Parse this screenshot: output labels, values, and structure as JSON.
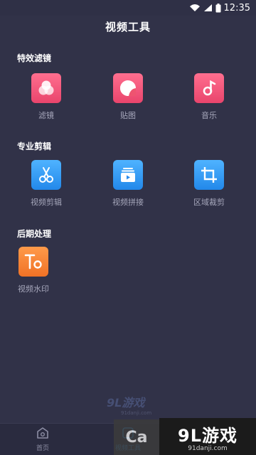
{
  "status_bar": {
    "time": "12:35"
  },
  "header": {
    "title": "视频工具"
  },
  "sections": [
    {
      "title": "特效滤镜",
      "items": [
        {
          "label": "滤镜",
          "icon": "filter-icon",
          "color": "#f0536f"
        },
        {
          "label": "贴图",
          "icon": "sticker-icon",
          "color": "#f0536f"
        },
        {
          "label": "音乐",
          "icon": "music-note-icon",
          "color": "#f0536f"
        }
      ]
    },
    {
      "title": "专业剪辑",
      "items": [
        {
          "label": "视频剪辑",
          "icon": "scissors-icon",
          "color": "#2f93f0"
        },
        {
          "label": "视频拼接",
          "icon": "video-stack-icon",
          "color": "#2f93f0"
        },
        {
          "label": "区域裁剪",
          "icon": "crop-icon",
          "color": "#2f93f0"
        }
      ]
    },
    {
      "title": "后期处理",
      "items": [
        {
          "label": "视频水印",
          "icon": "text-watermark-icon",
          "color": "#f7822f"
        }
      ]
    }
  ],
  "watermark": {
    "main": "9L游戏",
    "sub": "91danji.com"
  },
  "bottom_nav": {
    "items": [
      {
        "label": "首页",
        "icon": "home-icon"
      },
      {
        "label": "视频工具",
        "icon": "tools-icon"
      }
    ]
  },
  "brand": {
    "main": "9L游戏",
    "sub": "91danji.com",
    "logo_text": "Ca"
  },
  "colors": {
    "background": "#313248",
    "accent_pink": "#f0536f",
    "accent_blue": "#2f93f0",
    "accent_orange": "#f7822f",
    "label_gray": "#a6a7bb"
  }
}
